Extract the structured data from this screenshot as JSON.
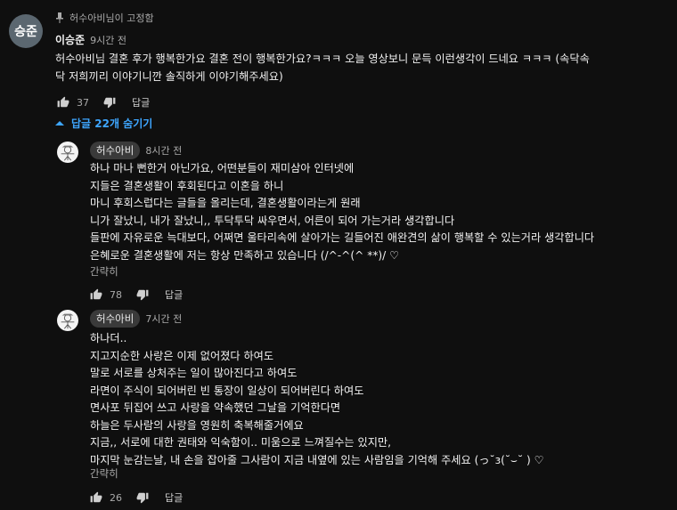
{
  "pinned_banner": {
    "icon": "pin-icon",
    "text": "허수아비님이 고정함"
  },
  "top_comment": {
    "avatar_initials": "승준",
    "author": "이승준",
    "time": "9시간 전",
    "lines": [
      "허수아비님 결혼 후가 행복한가요 결혼 전이 행복한가요?ㅋㅋㅋ 오늘 영상보니 문득 이런생각이 드네요 ㅋㅋㅋ (속닥속",
      "닥 저희끼리 이야기니깐 솔직하게 이야기해주세요)"
    ],
    "likes": "37",
    "reply_label": "답글"
  },
  "hide_replies": {
    "label": "답글 22개 숨기기"
  },
  "replies": [
    {
      "author": "허수아비",
      "time": "8시간 전",
      "lines": [
        "하나 마나 뻔한거 아닌가요,  어떤분들이 재미삼아 인터넷에",
        "지들은 결혼생활이 후회된다고 이혼을 하니",
        "마니 후회스럽다는 글들을 올리는데, 결혼생활이라는게 원래",
        "니가 잘났니, 내가 잘났니,, 투닥투닥 싸우면서, 어른이 되어 가는거라 생각합니다",
        "들판에 자유로운 늑대보다, 어쩌면 울타리속에 살아가는 길들어진 애완견의 삶이 행복할 수 있는거라 생각합니다",
        "은혜로운 결혼생활에 저는 항상 만족하고 있습니다  (/^-^(^ **)/ ♡"
      ],
      "read_more": "간략히",
      "likes": "78",
      "reply_label": "답글"
    },
    {
      "author": "허수아비",
      "time": "7시간 전",
      "lines": [
        "하나더..",
        "지고지순한 사랑은 이제 없어졌다 하여도",
        "말로 서로를 상처주는 일이 많아진다고 하여도",
        "라면이 주식이 되어버린 빈 통장이 일상이 되어버린다 하여도",
        "면사포 뒤집어 쓰고 사랑을 약속했던 그날을 기억한다면",
        "하늘은 두사람의 사랑을 영원히 축복해줄거에요",
        "지금,,  서로에 대한 권태와 익숙함이..   미움으로 느껴질수는 있지만,",
        "마지막 눈감는날, 내 손을 잡아줄 그사람이 지금 내옆에 있는 사람임을 기억해 주세요 (っ˘з(˘⌣˘ ) ♡"
      ],
      "read_more": "간략히",
      "likes": "26",
      "reply_label": "답글"
    }
  ],
  "icons": {
    "like": "thumbs-up-icon",
    "dislike": "thumbs-down-icon",
    "hide": "chevron-up-icon",
    "avatar": "scarecrow-avatar-icon"
  },
  "colors": {
    "background": "#0f0f0f",
    "accent": "#3ea6ff",
    "secondary_text": "#aaaaaa"
  }
}
